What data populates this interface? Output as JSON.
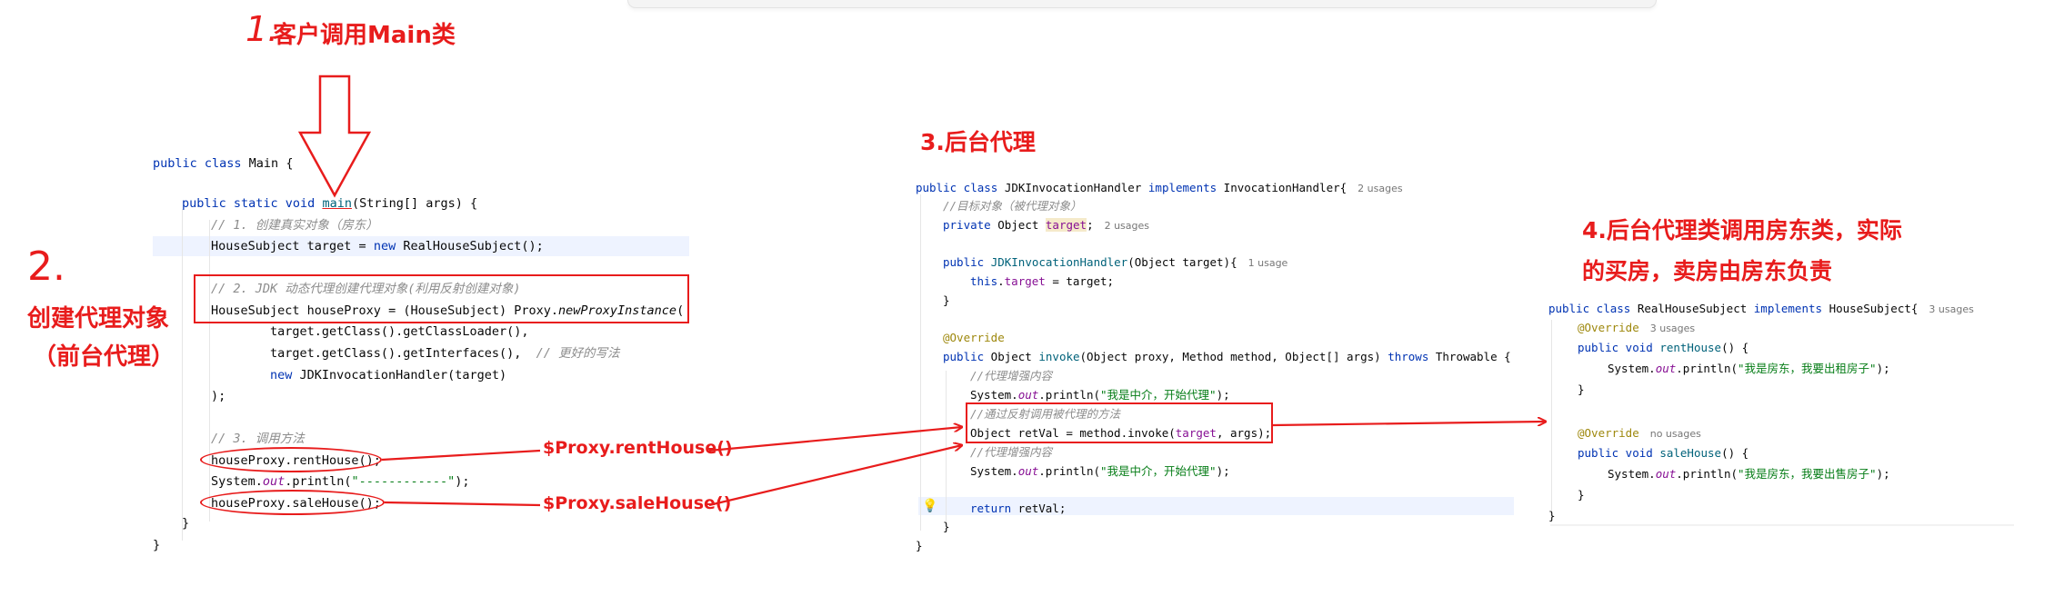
{
  "annotations": {
    "step1_number": "1.",
    "step1_text": "客户调用Main类",
    "step2_number": "2.",
    "step2_line1": "创建代理对象",
    "step2_line2": "（前台代理）",
    "step3_text": "3.后台代理",
    "step4_line1": "4.后台代理类调用房东类，实际",
    "step4_line2": "的买房，卖房由房东负责",
    "proxy_rent": "$Proxy.rentHouse()",
    "proxy_sale": "$Proxy.saleHouse()",
    "color": "#e81c1c"
  },
  "main_code": {
    "class_decl": {
      "kw": "public class",
      "name": " Main {"
    },
    "method_decl": {
      "kw1": "public static void",
      "name": "main",
      "rest": "(String[] args) {"
    },
    "c1": "// 1. 创建真实对象（房东）",
    "l_target": {
      "a": "HouseSubject target = ",
      "kw": "new",
      "b": " RealHouseSubject();"
    },
    "c2_prefix": "// 2. JDK ",
    "c2_rest": "动态代理创建代理对象(利用反射创建对象)",
    "l_proxy_a": "HouseSubject houseProxy = (HouseSubject) Proxy.",
    "l_proxy_b": "newProxyInstance",
    "l_proxy_c": "(",
    "l_loader": "target.getClass().getClassLoader(),",
    "l_ifaces_code": "target.getClass().getInterfaces(),",
    "l_ifaces_comment": "// 更好的写法",
    "l_handler": {
      "kw": "new",
      "b": " JDKInvocationHandler(target)"
    },
    "l_close": ");",
    "c3": "// 3. 调用方法",
    "l_rent": "houseProxy.rentHouse();",
    "l_print_a": "System.",
    "l_print_out": "out",
    "l_print_b": ".println(",
    "l_print_str": "\"------------\"",
    "l_print_c": ");",
    "l_sale": "houseProxy.saleHouse();",
    "brace": "}"
  },
  "handler_code": {
    "decl_kw": "public class",
    "decl_name": " JDKInvocationHandler ",
    "decl_impl": "implements",
    "decl_iface": " InvocationHandler{",
    "decl_hint": "2 usages",
    "c_target": "//目标对象（被代理对象）",
    "field_kw": "private",
    "field_type": " Object ",
    "field_name": "target",
    "field_end": ";",
    "field_hint": "2 usages",
    "ctor_kw": "public",
    "ctor_name": "JDKInvocationHandler",
    "ctor_rest": "(Object target){",
    "ctor_hint": "1 usage",
    "ctor_this": "this",
    "ctor_dot": ".",
    "ctor_field": "target",
    "ctor_end": " = target;",
    "close1": "}",
    "override": "@Override",
    "inv_kw": "public",
    "inv_type": " Object ",
    "inv_name": "invoke",
    "inv_rest": "(Object proxy, Method method, Object[] args) ",
    "inv_throws": "throws",
    "inv_end": " Throwable {",
    "c_enh1": "//代理增强内容",
    "p1_a": "System.",
    "p1_out": "out",
    "p1_b": ".println(",
    "p1_str": "\"我是中介，开始代理\"",
    "p1_c": ");",
    "c_reflect": "//通过反射调用被代理的方法",
    "ret_a": "Object retVal = method.invoke(",
    "ret_field": "target",
    "ret_b": ", args);",
    "c_enh2": "//代理增强内容",
    "p2_str": "\"我是中介，开始代理\"",
    "return_kw": "return",
    "return_rest": " retVal;",
    "close2": "}",
    "close3": "}"
  },
  "real_code": {
    "decl_kw": "public class",
    "decl_name": " RealHouseSubject ",
    "decl_impl": "implements",
    "decl_iface": " HouseSubject{",
    "decl_hint": "3 usages",
    "override1": "@Override",
    "override1_hint": "3 usages",
    "rent_kw": "public void",
    "rent_name": "rentHouse",
    "rent_rest": "() {",
    "rent_print_a": "System.",
    "rent_print_out": "out",
    "rent_print_b": ".println(",
    "rent_print_str": "\"我是房东，我要出租房子\"",
    "rent_print_c": ");",
    "close_rent": "}",
    "override2": "@Override",
    "override2_hint": "no usages",
    "sale_kw": "public void",
    "sale_name": "saleHouse",
    "sale_rest": "() {",
    "sale_print_str": "\"我是房东，我要出售房子\"",
    "close_sale": "}",
    "close_class": "}"
  }
}
